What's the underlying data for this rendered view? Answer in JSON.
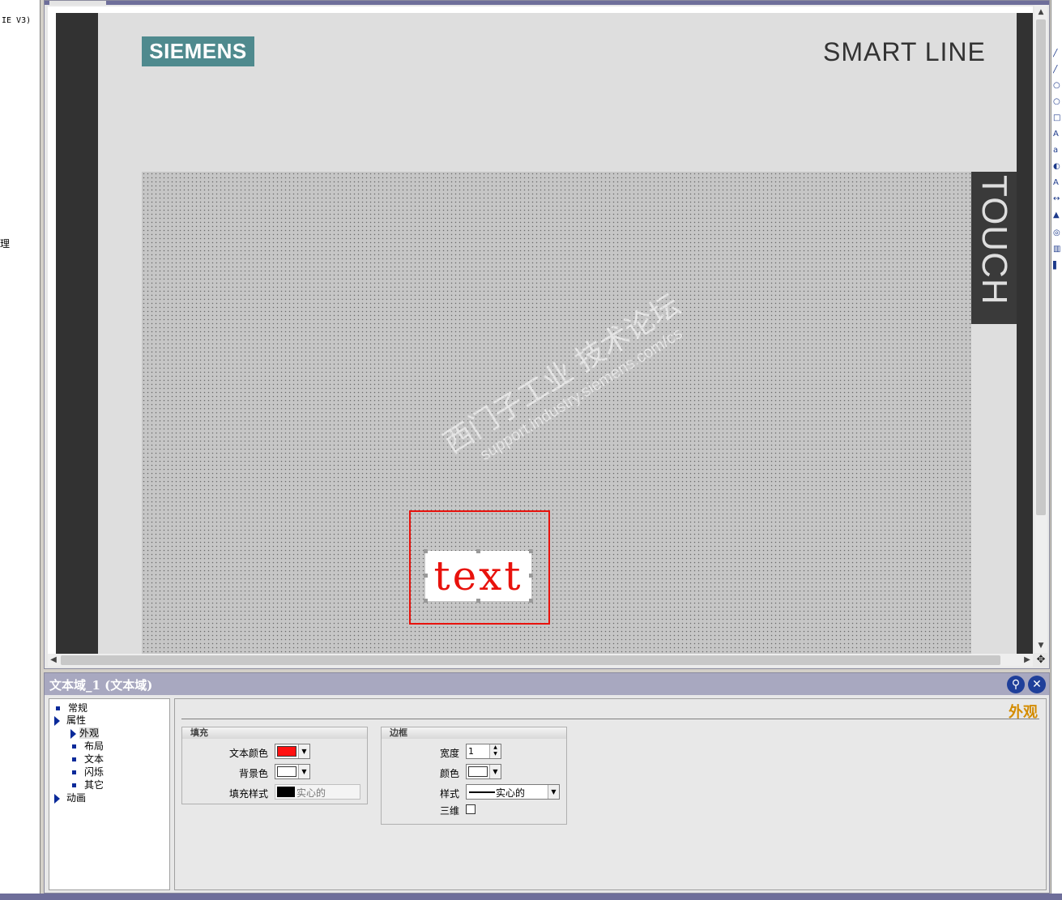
{
  "left_tree": {
    "line1": "IE V3)",
    "line2": "理"
  },
  "hmi_panel": {
    "brand": "SIEMENS",
    "product_line": "SMART LINE",
    "side_label": "TOUCH"
  },
  "text_object": {
    "text": "text",
    "text_color": "#e8120c",
    "background_color": "#ffffff"
  },
  "watermark": {
    "line1": "西门子工业  技术论坛",
    "line2": "support.industry.siemens.com/cs"
  },
  "properties": {
    "title": "文本域_1 (文本域)",
    "help_icon": "pin-icon",
    "close_icon": "close-icon",
    "section_title": "外观",
    "tree": [
      {
        "label": "常规",
        "kind": "leaf"
      },
      {
        "label": "属性",
        "kind": "expanded"
      },
      {
        "label": "外观",
        "kind": "selected"
      },
      {
        "label": "布局",
        "kind": "leaf"
      },
      {
        "label": "文本",
        "kind": "leaf"
      },
      {
        "label": "闪烁",
        "kind": "leaf"
      },
      {
        "label": "其它",
        "kind": "leaf"
      },
      {
        "label": "动画",
        "kind": "expanded"
      }
    ],
    "fill_group": {
      "title": "填充",
      "text_color_label": "文本颜色",
      "text_color_value": "#ff1010",
      "bg_color_label": "背景色",
      "bg_color_value": "#ffffff",
      "fill_style_label": "填充样式",
      "fill_style_value": "实心的",
      "fill_style_color": "#000000"
    },
    "border_group": {
      "title": "边框",
      "width_label": "宽度",
      "width_value": "1",
      "color_label": "颜色",
      "color_value": "#ffffff",
      "style_label": "样式",
      "style_value": "实心的",
      "three_d_label": "三维",
      "three_d_checked": false
    }
  }
}
